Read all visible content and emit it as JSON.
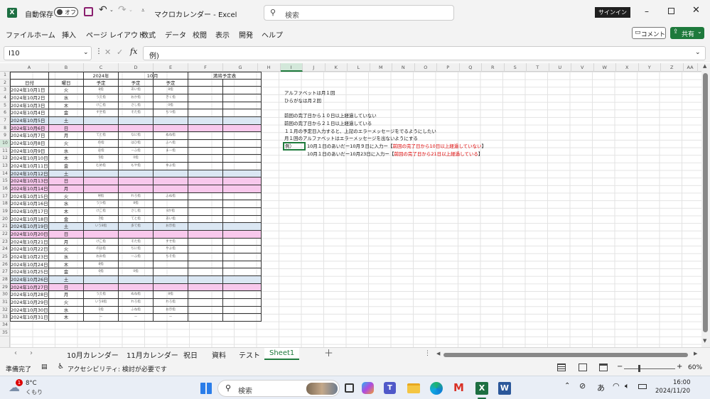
{
  "title": {
    "app_icon": "excel-icon",
    "autosave_label": "自動保存",
    "autosave_state": "オフ",
    "doc_title": "マクロカレンダー - Excel",
    "search_placeholder": "検索",
    "signin_label": "サインイン"
  },
  "menu": {
    "items": [
      "ファイル",
      "ホーム",
      "挿入",
      "ページ レイアウト",
      "数式",
      "データ",
      "校閲",
      "表示",
      "開発",
      "ヘルプ"
    ],
    "comment_label": "コメント",
    "share_label": "共有"
  },
  "formula": {
    "namebox": "I10",
    "value": "例)"
  },
  "columns": [
    "A",
    "B",
    "C",
    "D",
    "E",
    "F",
    "G",
    "H",
    "I",
    "J",
    "K",
    "L",
    "M",
    "N",
    "O",
    "P",
    "Q",
    "R",
    "S",
    "T",
    "U",
    "V",
    "W",
    "X",
    "Y",
    "Z",
    "AA"
  ],
  "calendar": {
    "year_label": "2024年",
    "month_num": "10",
    "month_unit": "月",
    "heading": "満将予定表",
    "headers": [
      "日付",
      "曜日",
      "予定",
      "予定",
      "予定"
    ],
    "rows": [
      {
        "date": "2024年10月1日",
        "dow": "火",
        "c": "8指",
        "d": "あい指",
        "e": "8指",
        "kind": "w"
      },
      {
        "date": "2024年10月2日",
        "dow": "水",
        "c": "うえ指",
        "d": "おか指",
        "e": "きく指",
        "kind": "w"
      },
      {
        "date": "2024年10月3日",
        "dow": "木",
        "c": "けこ指",
        "d": "さし指",
        "e": "0指",
        "kind": "w"
      },
      {
        "date": "2024年10月4日",
        "dow": "金",
        "c": "すせ指",
        "d": "そた指",
        "e": "ちつ指",
        "kind": "w"
      },
      {
        "date": "2024年10月5日",
        "dow": "土",
        "c": "",
        "d": "",
        "e": "",
        "kind": "sat"
      },
      {
        "date": "2024年10月6日",
        "dow": "日",
        "c": "",
        "d": "",
        "e": "",
        "kind": "sun"
      },
      {
        "date": "2024年10月7日",
        "dow": "月",
        "c": "てと指",
        "d": "なに指",
        "e": "ぬね指",
        "kind": "w"
      },
      {
        "date": "2024年10月8日",
        "dow": "火",
        "c": "の指",
        "d": "はひ指",
        "e": "ふへ指",
        "kind": "w"
      },
      {
        "date": "2024年10月9日",
        "dow": "水",
        "c": "ほ指",
        "d": "ーふ指",
        "e": "ま一指",
        "kind": "w"
      },
      {
        "date": "2024年10月10日",
        "dow": "木",
        "c": "5指",
        "d": "0指",
        "e": "",
        "kind": "w"
      },
      {
        "date": "2024年10月11日",
        "dow": "金",
        "c": "むめ指",
        "d": "もや指",
        "e": "ゆよ指",
        "kind": "w"
      },
      {
        "date": "2024年10月12日",
        "dow": "土",
        "c": "",
        "d": "",
        "e": "",
        "kind": "sat"
      },
      {
        "date": "2024年10月13日",
        "dow": "日",
        "c": "",
        "d": "",
        "e": "",
        "kind": "sun"
      },
      {
        "date": "2024年10月14日",
        "dow": "月",
        "c": "",
        "d": "",
        "e": "",
        "kind": "sun"
      },
      {
        "date": "2024年10月15日",
        "dow": "火",
        "c": "M指",
        "d": "れろ指",
        "e": "ふぬ指",
        "kind": "w"
      },
      {
        "date": "2024年10月16日",
        "dow": "水",
        "c": "うつ指",
        "d": "8指",
        "e": "",
        "kind": "w"
      },
      {
        "date": "2024年10月17日",
        "dow": "木",
        "c": "けこ指",
        "d": "さし指",
        "e": "8か指",
        "kind": "w"
      },
      {
        "date": "2024年10月18日",
        "dow": "金",
        "c": "7指",
        "d": "てと指",
        "e": "あい指",
        "kind": "w"
      },
      {
        "date": "2024年10月19日",
        "dow": "土",
        "c": "いう8指",
        "d": "多て指",
        "e": "お示指",
        "kind": "sat"
      },
      {
        "date": "2024年10月20日",
        "dow": "日",
        "c": "",
        "d": "",
        "e": "",
        "kind": "sun"
      },
      {
        "date": "2024年10月21日",
        "dow": "月",
        "c": "けこ指",
        "d": "そた指",
        "e": "すせ指",
        "kind": "w"
      },
      {
        "date": "2024年10月22日",
        "dow": "火",
        "c": "のは指",
        "d": "ちに指",
        "e": "やよ指",
        "kind": "w"
      },
      {
        "date": "2024年10月23日",
        "dow": "水",
        "c": "おみ指",
        "d": "一ふ指",
        "e": "ちそ指",
        "kind": "w"
      },
      {
        "date": "2024年10月24日",
        "dow": "木",
        "c": "8指",
        "d": "",
        "e": "",
        "kind": "w"
      },
      {
        "date": "2024年10月25日",
        "dow": "金",
        "c": "0指",
        "d": "0指",
        "e": "",
        "kind": "w"
      },
      {
        "date": "2024年10月26日",
        "dow": "土",
        "c": "",
        "d": "",
        "e": "",
        "kind": "sat"
      },
      {
        "date": "2024年10月27日",
        "dow": "日",
        "c": "",
        "d": "",
        "e": "",
        "kind": "sun"
      },
      {
        "date": "2024年10月28日",
        "dow": "月",
        "c": "うえ指",
        "d": "ぬね指",
        "e": "8指",
        "kind": "w"
      },
      {
        "date": "2024年10月29日",
        "dow": "火",
        "c": "いう8指",
        "d": "れろ指",
        "e": "れろ指",
        "kind": "w"
      },
      {
        "date": "2024年10月30日",
        "dow": "水",
        "c": "1指",
        "d": "ふね指",
        "e": "お示指",
        "kind": "w"
      },
      {
        "date": "2024年10月31日",
        "dow": "木",
        "c": "ー",
        "d": "ー",
        "e": "ー",
        "kind": "w"
      }
    ]
  },
  "notes": {
    "n1": "アルファベットは月１回",
    "n2": "ひらがなは月２回",
    "n3": "前回の完了日から１０日以上経過していない",
    "n4": "前回の完了日から２１日以上経過している",
    "n5": "１１月の予定日入力すると、上記のエラーメッセージをでるようにしたい",
    "n6": "月１回のアルファベットはエラーメッセージを出ないようにする",
    "ex_label": "例）",
    "ex1a": "10月１日のあいだー10月９日に入力ー【",
    "ex1b": "前回の完了日から10日以上経過していない",
    "ex1c": "】",
    "ex2a": "10月１日のあいだー10月23日に入力ー【",
    "ex2b": "前回の完了日から21日以上経過している",
    "ex2c": "】"
  },
  "sheets": [
    "10月カレンダー",
    "11月カレンダー",
    "祝日",
    "資料",
    "テスト",
    "Sheet1"
  ],
  "active_sheet": "Sheet1",
  "status": {
    "ready": "準備完了",
    "accessibility": "アクセシビリティ: 検討が必要です",
    "zoom": "60%"
  },
  "taskbar": {
    "weather_temp": "8°C",
    "weather_desc": "くもり",
    "search_placeholder": "検索",
    "ime": "あ",
    "time": "16:00",
    "date": "2024/11/20",
    "badge": "1"
  },
  "colors": {
    "sat": "#dbe7f3",
    "sun": "#f8c8ec",
    "excel_green": "#1d6f42",
    "share_green": "#1e7a3c",
    "accent_red": "#d00000"
  }
}
